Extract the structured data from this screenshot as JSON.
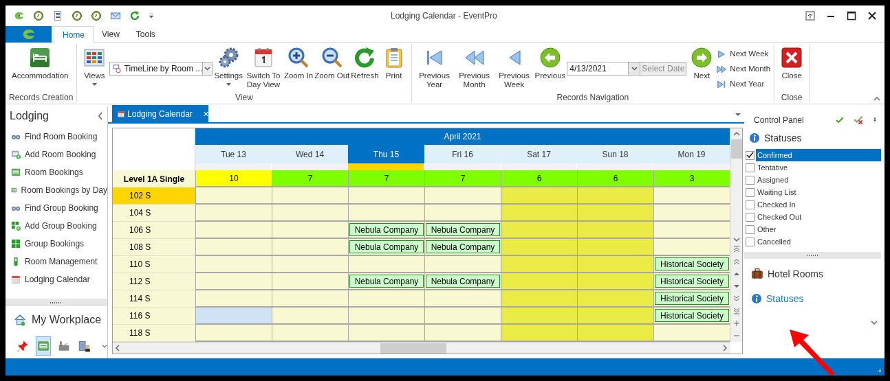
{
  "window": {
    "title": "Lodging Calendar - EventPro"
  },
  "ribbon_tabs": [
    {
      "label": "Home",
      "selected": true
    },
    {
      "label": "View",
      "selected": false
    },
    {
      "label": "Tools",
      "selected": false
    }
  ],
  "ribbon": {
    "groups": [
      {
        "label": "Records Creation",
        "items": [
          {
            "kind": "wide",
            "label": "Accommodation"
          }
        ]
      },
      {
        "label": "View",
        "items": [
          {
            "kind": "large",
            "label": "Views",
            "dropdown": true
          },
          {
            "kind": "combo",
            "value": "TimeLine by Room ..."
          },
          {
            "kind": "large",
            "label": "Settings",
            "dropdown": true
          },
          {
            "kind": "large",
            "label": "Switch To Day View"
          },
          {
            "kind": "large",
            "label": "Zoom In"
          },
          {
            "kind": "large",
            "label": "Zoom Out"
          },
          {
            "kind": "large",
            "label": "Refresh"
          },
          {
            "kind": "large",
            "label": "Print"
          }
        ]
      },
      {
        "label": "Records Navigation",
        "items": [
          {
            "kind": "large",
            "label": "Previous Year"
          },
          {
            "kind": "large",
            "label": "Previous Month"
          },
          {
            "kind": "large",
            "label": "Previous Week"
          },
          {
            "kind": "large",
            "label": "Previous"
          },
          {
            "kind": "date",
            "value": "4/13/2021",
            "button": "Select Date"
          },
          {
            "kind": "large",
            "label": "Next"
          },
          {
            "kind": "small",
            "labels": [
              "Next Week",
              "Next Month",
              "Next Year"
            ]
          }
        ]
      },
      {
        "label": "Close",
        "items": [
          {
            "kind": "large",
            "label": "Close"
          }
        ]
      }
    ]
  },
  "nav_pane": {
    "title": "Lodging",
    "items": [
      "Find Room Booking",
      "Add Room Booking",
      "Room Bookings",
      "Room Bookings by Day",
      "Find Group Booking",
      "Add Group Booking",
      "Group Bookings",
      "Room Management",
      "Lodging Calendar"
    ],
    "workplace": "My Workplace",
    "toolbar": [
      {
        "selected": false
      },
      {
        "selected": true
      },
      {
        "selected": false
      },
      {
        "selected": false
      }
    ]
  },
  "document_tab": {
    "label": "Lodging Calendar"
  },
  "calendar": {
    "month": "April 2021",
    "group": "Level 1A Single",
    "days": [
      {
        "label": "Tue 13",
        "selected": false,
        "weekend": false,
        "count": "10",
        "color": "#ffff00"
      },
      {
        "label": "Wed 14",
        "selected": false,
        "weekend": false,
        "count": "7",
        "color": "#7fff00"
      },
      {
        "label": "Thu 15",
        "selected": true,
        "weekend": false,
        "count": "7",
        "color": "#7fff00"
      },
      {
        "label": "Fri 16",
        "selected": false,
        "weekend": false,
        "count": "7",
        "color": "#7fff00"
      },
      {
        "label": "Sat 17",
        "selected": false,
        "weekend": true,
        "count": "6",
        "color": "#7fff00"
      },
      {
        "label": "Sun 18",
        "selected": false,
        "weekend": true,
        "count": "6",
        "color": "#7fff00"
      },
      {
        "label": "Mon 19",
        "selected": false,
        "weekend": false,
        "count": "3",
        "color": "#7fff00"
      }
    ],
    "rooms": [
      {
        "name": "102 S",
        "selected": true,
        "cells": [
          {
            "selected": false
          },
          {
            "selected": false
          },
          {
            "selected": false
          },
          {
            "selected": false
          },
          {
            "selected": false
          },
          {
            "selected": false
          },
          {
            "selected": false
          }
        ]
      },
      {
        "name": "104 S",
        "selected": false,
        "cells": [
          {
            "selected": false
          },
          {
            "selected": false
          },
          {
            "selected": false
          },
          {
            "selected": false
          },
          {
            "selected": false
          },
          {
            "selected": false
          },
          {
            "selected": false
          }
        ]
      },
      {
        "name": "106 S",
        "selected": false,
        "cells": [
          {
            "selected": false
          },
          {
            "selected": false
          },
          {
            "selected": false,
            "booking": "Nebula Company"
          },
          {
            "selected": false,
            "booking": "Nebula Company"
          },
          {
            "selected": false
          },
          {
            "selected": false
          },
          {
            "selected": false
          }
        ]
      },
      {
        "name": "108 S",
        "selected": false,
        "cells": [
          {
            "selected": false
          },
          {
            "selected": false
          },
          {
            "selected": false,
            "booking": "Nebula Company"
          },
          {
            "selected": false,
            "booking": "Nebula Company"
          },
          {
            "selected": false
          },
          {
            "selected": false
          },
          {
            "selected": false
          }
        ]
      },
      {
        "name": "110 S",
        "selected": false,
        "cells": [
          {
            "selected": false
          },
          {
            "selected": false
          },
          {
            "selected": false
          },
          {
            "selected": false
          },
          {
            "selected": false
          },
          {
            "selected": false
          },
          {
            "selected": false,
            "booking": "Historical Society"
          }
        ]
      },
      {
        "name": "112 S",
        "selected": false,
        "cells": [
          {
            "selected": false
          },
          {
            "selected": false
          },
          {
            "selected": false,
            "booking": "Nebula Company"
          },
          {
            "selected": false,
            "booking": "Nebula Company"
          },
          {
            "selected": false
          },
          {
            "selected": false
          },
          {
            "selected": false,
            "booking": "Historical Society"
          }
        ]
      },
      {
        "name": "114 S",
        "selected": false,
        "cells": [
          {
            "selected": false
          },
          {
            "selected": false
          },
          {
            "selected": false
          },
          {
            "selected": false
          },
          {
            "selected": false
          },
          {
            "selected": false
          },
          {
            "selected": false,
            "booking": "Historical Society"
          }
        ]
      },
      {
        "name": "116 S",
        "selected": false,
        "cells": [
          {
            "selected": true
          },
          {
            "selected": false
          },
          {
            "selected": false
          },
          {
            "selected": false
          },
          {
            "selected": false
          },
          {
            "selected": false
          },
          {
            "selected": false,
            "booking": "Historical Society"
          }
        ]
      },
      {
        "name": "118 S",
        "selected": false,
        "cells": [
          {
            "selected": false
          },
          {
            "selected": false
          },
          {
            "selected": false
          },
          {
            "selected": false
          },
          {
            "selected": false
          },
          {
            "selected": false
          },
          {
            "selected": false
          }
        ]
      }
    ]
  },
  "control_panel": {
    "title": "Control Panel",
    "heading": "Statuses",
    "statuses": [
      {
        "label": "Confirmed",
        "checked": true,
        "selected": true
      },
      {
        "label": "Tentative",
        "checked": false,
        "selected": false
      },
      {
        "label": "Assigned",
        "checked": false,
        "selected": false
      },
      {
        "label": "Waiting List",
        "checked": false,
        "selected": false
      },
      {
        "label": "Checked In",
        "checked": false,
        "selected": false
      },
      {
        "label": "Checked Out",
        "checked": false,
        "selected": false
      },
      {
        "label": "Other",
        "checked": false,
        "selected": false
      },
      {
        "label": "Cancelled",
        "checked": false,
        "selected": false
      }
    ],
    "sections": [
      {
        "label": "Hotel Rooms",
        "kind": "rooms"
      },
      {
        "label": "Statuses",
        "kind": "info"
      }
    ]
  }
}
